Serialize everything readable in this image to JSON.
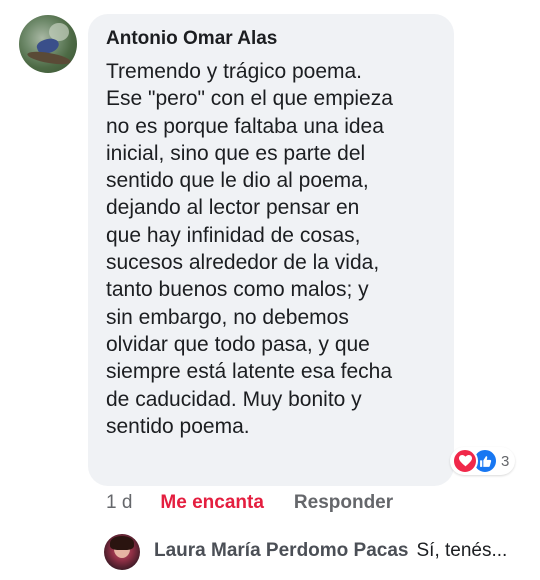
{
  "comment": {
    "author": "Antonio Omar Alas",
    "lines": [
      "Tremendo y trágico poema.",
      "Ese \"pero\" con el que empieza",
      "no es porque faltaba una idea",
      "inicial, sino que es parte del",
      "sentido que le dio al poema,",
      "dejando al lector pensar en",
      "que hay infinidad de cosas,",
      "sucesos alrededor de la vida,",
      "tanto buenos como malos; y",
      "sin embargo, no debemos",
      "olvidar que todo pasa, y que",
      "siempre está latente esa fecha",
      "de caducidad. Muy bonito y",
      "sentido poema."
    ],
    "reactions": {
      "icons": [
        "love-icon",
        "like-icon"
      ],
      "count": "3",
      "colors": {
        "love": "#f0284a",
        "like": "#1877f2"
      }
    }
  },
  "actions": {
    "time": "1 d",
    "love_label": "Me encanta",
    "reply_label": "Responder"
  },
  "reply_preview": {
    "name": "Laura María Perdomo Pacas",
    "snippet": "Sí, tenés..."
  },
  "colors": {
    "bubble": "#f0f2f5",
    "love_action": "#e41e3f",
    "muted": "#65676b"
  }
}
